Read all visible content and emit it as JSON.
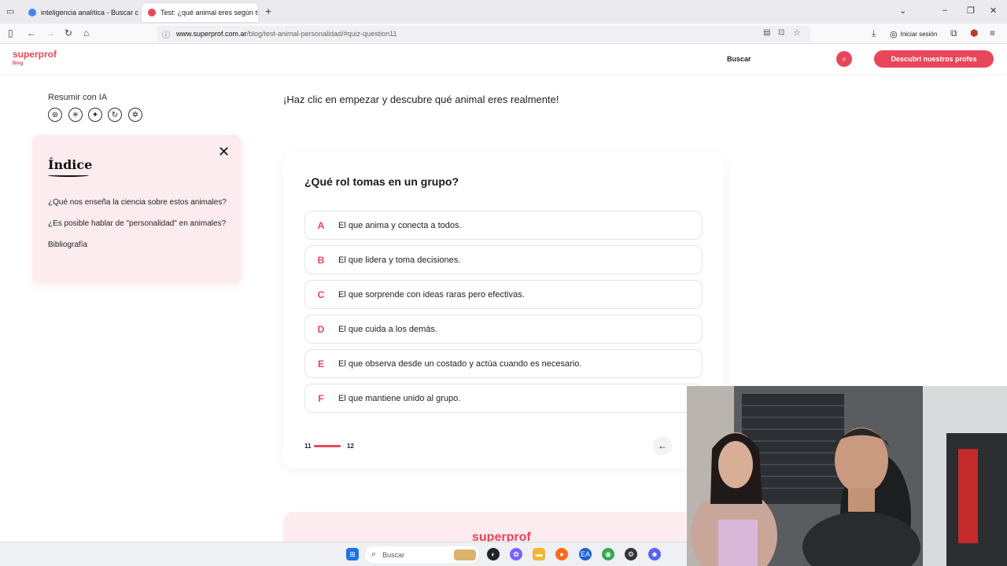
{
  "browser": {
    "tabs": [
      {
        "title": "inteligencia analítica - Buscar c",
        "favicon_color": "#4285f4"
      },
      {
        "title": "Test: ¿qué animal eres según tu",
        "favicon_color": "#e8465a"
      }
    ],
    "url_host": "www.superprof.com.ar",
    "url_path": "/blog/test-animal-personalidad/#quiz-question11",
    "signin_label": "Iniciar sesión"
  },
  "site": {
    "logo": "superprof",
    "logo_sub": "Blog",
    "search_label": "Buscar",
    "cta_label": "Descubrí nuestros profes",
    "accent": "#e8465a"
  },
  "sidebar": {
    "ai_label": "Resumir con IA",
    "ai_icons": [
      "openai-icon",
      "claude-icon",
      "gemini-icon",
      "perplexity-icon",
      "mistral-icon"
    ],
    "index": {
      "title": "Índice",
      "items": [
        "¿Qué nos enseña la ciencia sobre estos animales?",
        "¿Es posible hablar de \"personalidad\" en animales?",
        "Bibliografía"
      ]
    }
  },
  "quiz": {
    "intro": "¡Haz clic en empezar y descubre qué animal eres realmente!",
    "question": "¿Qué rol tomas en un grupo?",
    "options": [
      {
        "letter": "A",
        "text": "El que anima y conecta a todos."
      },
      {
        "letter": "B",
        "text": "El que lidera y toma decisiones."
      },
      {
        "letter": "C",
        "text": "El que sorprende con ideas raras pero efectivas."
      },
      {
        "letter": "D",
        "text": "El que cuida a los demás."
      },
      {
        "letter": "E",
        "text": "El que observa desde un costado y actúa cuando es necesario."
      },
      {
        "letter": "F",
        "text": "El que mantiene unido al grupo."
      }
    ],
    "progress_current": "11",
    "progress_total": "12"
  },
  "footer": {
    "logo": "superprof"
  },
  "taskbar": {
    "search_placeholder": "Buscar"
  }
}
